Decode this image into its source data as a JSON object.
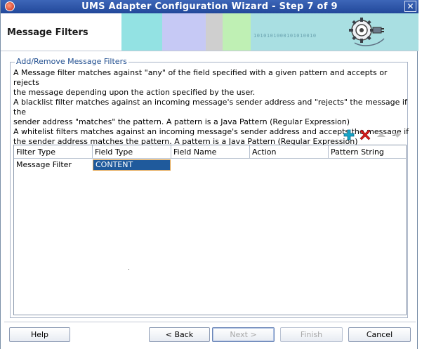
{
  "window": {
    "title": "UMS Adapter Configuration Wizard - Step 7 of 9",
    "close_glyph": "✕"
  },
  "banner": {
    "heading": "Message Filters",
    "binary_text": "1010101000101010010"
  },
  "group": {
    "legend": "Add/Remove Message Filters",
    "description": [
      "A Message filter matches against \"any\" of the field specified with a given pattern and accepts or rejects",
      "the message depending upon the action specified by the user.",
      "A blacklist filter matches against an incoming message's sender address and \"rejects\" the message if the",
      "sender address \"matches\" the pattern. A pattern is a Java Pattern (Regular Expression)",
      "A whitelist filters matches against an incoming message's sender address and accepts the message if",
      "the sender address matches the pattern. A pattern is a Java Pattern (Regular Expression)"
    ]
  },
  "toolbar": {
    "icons": {
      "add": "plus-icon",
      "remove": "delete-icon",
      "up": "arrow-up-icon",
      "down": "arrow-down-icon"
    },
    "colors": {
      "add": "#17a5c8",
      "remove": "#d41a1a",
      "disabled": "#c4c4c4"
    }
  },
  "table": {
    "columns": [
      "Filter Type",
      "Field Type",
      "Field Name",
      "Action",
      "Pattern String"
    ],
    "rows": [
      [
        "Message Filter",
        "CONTENT",
        "",
        "",
        ""
      ]
    ],
    "selected_cell": "CONTENT"
  },
  "buttons": {
    "help": "Help",
    "back": "< Back",
    "next": "Next >",
    "finish": "Finish",
    "cancel": "Cancel"
  }
}
